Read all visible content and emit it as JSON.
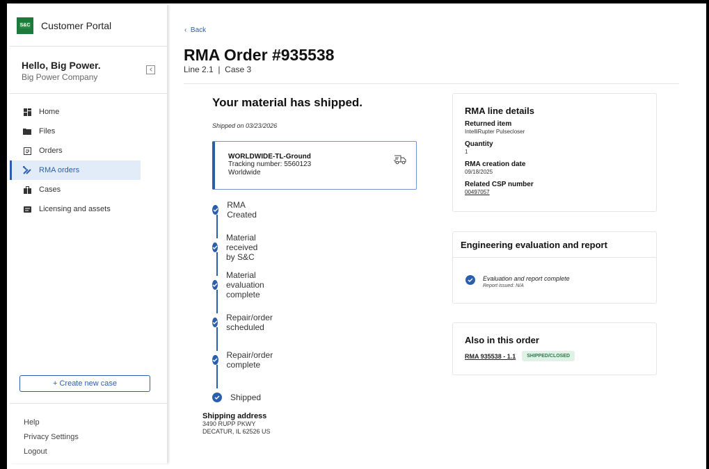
{
  "app": {
    "title": "Customer Portal",
    "logo_text": "S&C"
  },
  "user": {
    "greeting": "Hello, Big Power.",
    "company": "Big Power Company"
  },
  "nav": [
    {
      "label": "Home",
      "icon": "grid-icon",
      "active": false
    },
    {
      "label": "Files",
      "icon": "folder-icon",
      "active": false
    },
    {
      "label": "Orders",
      "icon": "orders-icon",
      "active": false
    },
    {
      "label": "RMA orders",
      "icon": "wrench-icon",
      "active": true
    },
    {
      "label": "Cases",
      "icon": "briefcase-icon",
      "active": false
    },
    {
      "label": "Licensing and assets",
      "icon": "license-icon",
      "active": false
    }
  ],
  "create_case": "+ Create new case",
  "footer_links": [
    "Help",
    "Privacy Settings",
    "Logout"
  ],
  "header": {
    "back": "Back",
    "title": "RMA Order #935538",
    "subtitle": "Line 2.1  |  Case 3"
  },
  "status": {
    "heading": "Your material has shipped.",
    "shipped_on": "Shipped on 03/23/2026"
  },
  "tracking": {
    "carrier": "WORLDWIDE-TL-Ground",
    "tracking_number": "Tracking number: 5560123",
    "region": "Worldwide"
  },
  "timeline": [
    "RMA Created",
    "Material received by S&C",
    "Material evaluation complete",
    "Repair/order scheduled",
    "Repair/order complete",
    "Shipped"
  ],
  "shipping_address": {
    "heading": "Shipping address",
    "line1": "3490 RUPP PKWY",
    "line2": "DECATUR, IL 62526 US"
  },
  "rma_details": {
    "title": "RMA line details",
    "returned_item_label": "Returned item",
    "returned_item": "IntelliRupter Pulsecloser",
    "quantity_label": "Quantity",
    "quantity": "1",
    "creation_date_label": "RMA creation date",
    "creation_date": "09/18/2025",
    "csp_label": "Related CSP number",
    "csp": "00497057"
  },
  "evaluation": {
    "title": "Engineering evaluation and report",
    "status": "Evaluation and report complete",
    "report": "Report issued: N/A"
  },
  "also": {
    "title": "Also in this order",
    "link": "RMA 935538 - 1.1",
    "badge": "SHIPPED/CLOSED"
  },
  "colors": {
    "accent": "#2b5fad",
    "badge_bg": "#dff2e6",
    "badge_text": "#2d7a4a",
    "logo": "#1e7a3a"
  }
}
